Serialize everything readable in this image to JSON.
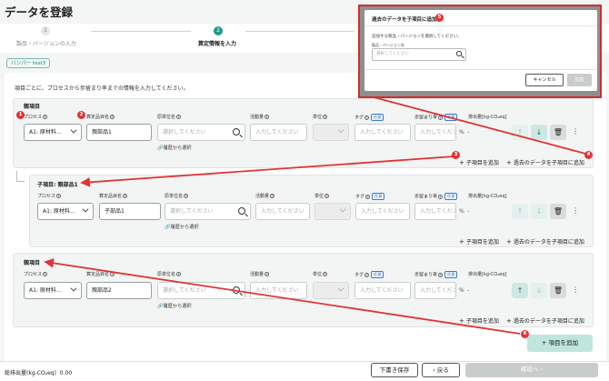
{
  "page": {
    "title": "データを登録"
  },
  "steps": [
    {
      "num": "1",
      "label": "製品・バージョンの入力"
    },
    {
      "num": "2",
      "label": "算定情報を入力"
    }
  ],
  "chip": "バンパー test3",
  "instruction": "項目ごとに、プロセスから歩留まり率までの情報を入力してください。",
  "labels": {
    "process": "プロセス",
    "item_name": "算定品目名",
    "unit_name": "原単位名",
    "activity": "活動量",
    "unit": "単位",
    "tag": "タグ",
    "yield": "歩留まり率",
    "optional": "任意",
    "emission": "排出量[kg-CO₂eq]"
  },
  "sections": [
    {
      "title": "親項目",
      "process": "A1: 原材料…",
      "item_name": "親部品1",
      "unit_name_placeholder": "選択してください",
      "activity_placeholder": "入力してください",
      "tag_placeholder": "入力してください",
      "yield_placeholder": "入力してくださ",
      "percent": "%",
      "emission": "-",
      "history_link": "履歴から選択",
      "add_child": "子項目を追加",
      "add_from_past": "過去のデータを子項目に追加"
    },
    {
      "title": "子項目: 親部品1",
      "process": "A1: 原材料…",
      "item_name": "子部品1",
      "unit_name_placeholder": "選択してください",
      "activity_placeholder": "入力してください",
      "tag_placeholder": "入力してください",
      "yield_placeholder": "入力してくださ",
      "percent": "%",
      "emission": "-",
      "history_link": "履歴から選択",
      "add_child": "子項目を追加",
      "add_from_past": "過去のデータを子項目に追加"
    },
    {
      "title": "親項目",
      "process": "A1: 原材料…",
      "item_name": "親部品2",
      "unit_name_placeholder": "選択してください",
      "activity_placeholder": "入力してください",
      "tag_placeholder": "入力してください",
      "yield_placeholder": "入力してくださ",
      "percent": "%",
      "emission": "-",
      "history_link": "履歴から選択",
      "add_child": "子項目を追加",
      "add_from_past": "過去のデータを子項目に追加"
    }
  ],
  "add_item": "項目を追加",
  "footer": {
    "total_label": "総排出量(kg-CO₂eq)",
    "total_value": "0.00",
    "draft": "下書き保存",
    "back": "戻る",
    "confirm": "確認へ"
  },
  "modal": {
    "title": "過去のデータを子項目に追加",
    "description": "追加する製品・バージョンを選択してください。",
    "field_label": "製品・バージョン名",
    "placeholder": "選択してください",
    "cancel": "キャンセル",
    "add": "追加"
  },
  "markers": [
    "1",
    "2",
    "3",
    "4",
    "5",
    "6"
  ],
  "colors": {
    "accent": "#1e9b87",
    "marker": "#e03535",
    "button_green": "#bfe6dc"
  },
  "icons": {
    "search": "search-icon",
    "history": "link-icon",
    "up": "arrow-up-icon",
    "down": "arrow-down-icon",
    "delete": "trash-icon",
    "more": "kebab-icon",
    "add": "plus-icon"
  }
}
